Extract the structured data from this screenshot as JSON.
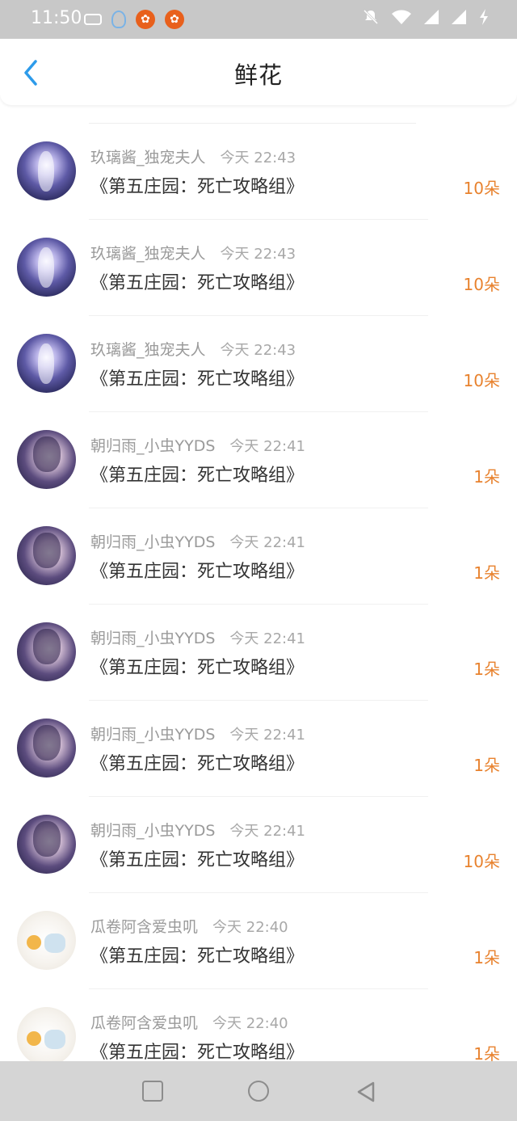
{
  "status_bar": {
    "time": "11:50",
    "icons_left": [
      "gamepad-icon",
      "qq-icon",
      "app-icon",
      "app-icon"
    ],
    "icons_right": [
      "mute-icon",
      "wifi-icon",
      "signal-icon",
      "signal-icon",
      "charging-icon"
    ]
  },
  "header": {
    "title": "鲜花",
    "back_icon": "chevron-left-icon"
  },
  "colors": {
    "accent_blue": "#2d9bea",
    "count_orange": "#e8822e",
    "name_gray": "#9a9a9a"
  },
  "rows": [
    {
      "user": "玖璃酱_独宠夫人",
      "time": "今天 22:43",
      "title": "《第五庄园：死亡攻略组》",
      "count": "10朵"
    },
    {
      "user": "玖璃酱_独宠夫人",
      "time": "今天 22:43",
      "title": "《第五庄园：死亡攻略组》",
      "count": "10朵"
    },
    {
      "user": "玖璃酱_独宠夫人",
      "time": "今天 22:43",
      "title": "《第五庄园：死亡攻略组》",
      "count": "10朵"
    },
    {
      "user": "朝归雨_小虫YYDS",
      "time": "今天 22:41",
      "title": "《第五庄园：死亡攻略组》",
      "count": "1朵"
    },
    {
      "user": "朝归雨_小虫YYDS",
      "time": "今天 22:41",
      "title": "《第五庄园：死亡攻略组》",
      "count": "1朵"
    },
    {
      "user": "朝归雨_小虫YYDS",
      "time": "今天 22:41",
      "title": "《第五庄园：死亡攻略组》",
      "count": "1朵"
    },
    {
      "user": "朝归雨_小虫YYDS",
      "time": "今天 22:41",
      "title": "《第五庄园：死亡攻略组》",
      "count": "1朵"
    },
    {
      "user": "朝归雨_小虫YYDS",
      "time": "今天 22:41",
      "title": "《第五庄园：死亡攻略组》",
      "count": "10朵"
    },
    {
      "user": "瓜卷阿含爱虫叽",
      "time": "今天 22:40",
      "title": "《第五庄园：死亡攻略组》",
      "count": "1朵"
    },
    {
      "user": "瓜卷阿含爱虫叽",
      "time": "今天 22:40",
      "title": "《第五庄园：死亡攻略组》",
      "count": "1朵"
    }
  ],
  "nav_bar": {
    "buttons": [
      "recents-button",
      "home-button",
      "back-button"
    ]
  }
}
